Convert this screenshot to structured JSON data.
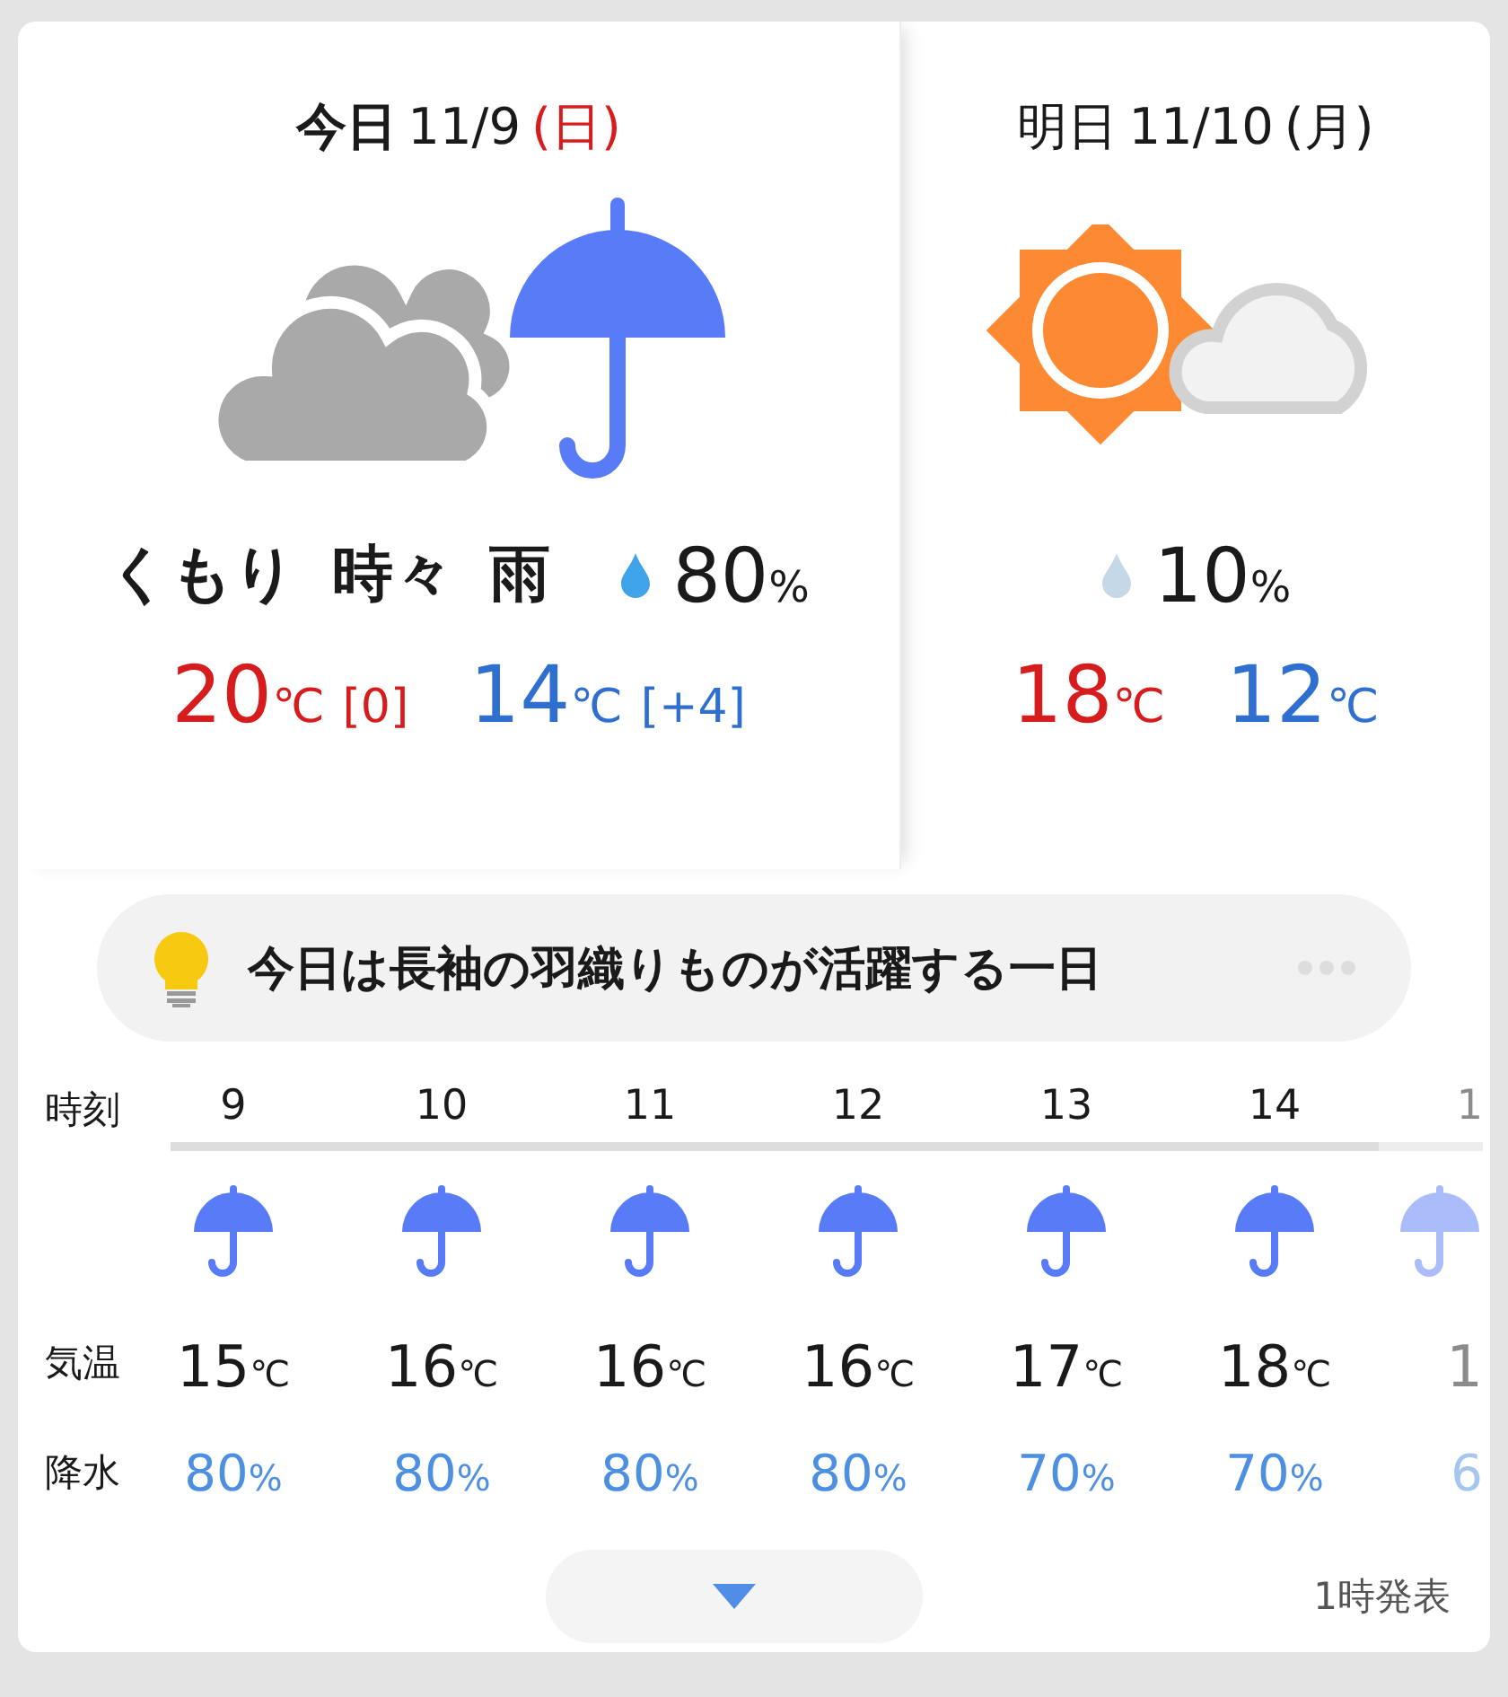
{
  "days": [
    {
      "label": "今日",
      "date": "11/9",
      "weekday": "(日)",
      "sunday": true,
      "weather": "くもり 時々 雨",
      "precip": "80",
      "precip_unit": "%",
      "high": "20",
      "high_unit": "℃",
      "high_diff": "[0]",
      "low": "14",
      "low_unit": "℃",
      "low_diff": "[+4]"
    },
    {
      "label": "明日",
      "date": "11/10",
      "weekday": "(月)",
      "sunday": false,
      "precip": "10",
      "precip_unit": "%",
      "high": "18",
      "high_unit": "℃",
      "low": "12",
      "low_unit": "℃"
    }
  ],
  "hint": {
    "text": "今日は長袖の羽織りものが活躍する一日"
  },
  "hourly": {
    "row_labels": [
      "時刻",
      "気温",
      "降水"
    ],
    "hours": [
      {
        "time": "9",
        "temp": "15",
        "temp_unit": "℃",
        "precip": "80",
        "precip_unit": "%",
        "faded": false
      },
      {
        "time": "10",
        "temp": "16",
        "temp_unit": "℃",
        "precip": "80",
        "precip_unit": "%",
        "faded": false
      },
      {
        "time": "11",
        "temp": "16",
        "temp_unit": "℃",
        "precip": "80",
        "precip_unit": "%",
        "faded": false
      },
      {
        "time": "12",
        "temp": "16",
        "temp_unit": "℃",
        "precip": "80",
        "precip_unit": "%",
        "faded": false
      },
      {
        "time": "13",
        "temp": "17",
        "temp_unit": "℃",
        "precip": "70",
        "precip_unit": "%",
        "faded": false
      },
      {
        "time": "14",
        "temp": "18",
        "temp_unit": "℃",
        "precip": "70",
        "precip_unit": "%",
        "faded": false
      },
      {
        "time": "1",
        "temp": "1",
        "precip": "6",
        "faded": true
      }
    ]
  },
  "footer": {
    "issued": "1時発表"
  }
}
